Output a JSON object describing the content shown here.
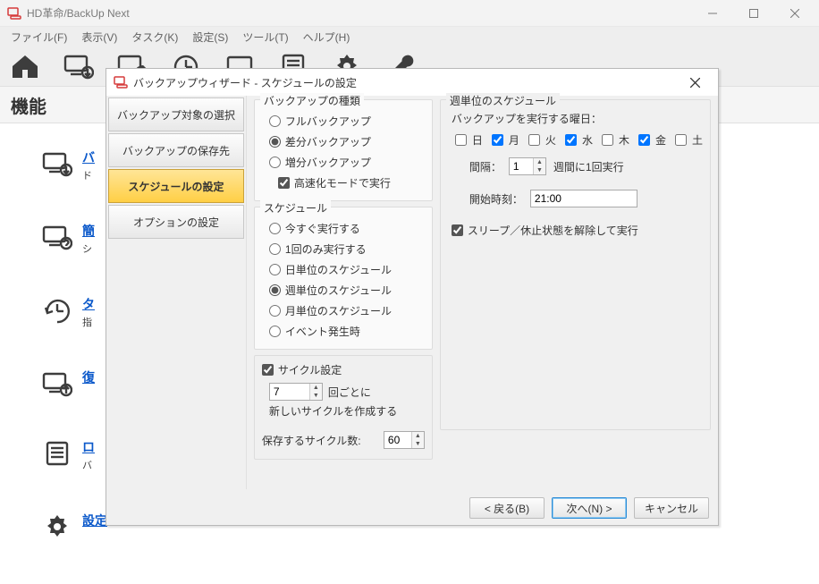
{
  "app": {
    "title": "HD革命/BackUp Next"
  },
  "menu": {
    "file": "ファイル(F)",
    "view": "表示(V)",
    "task": "タスク(K)",
    "settings": "設定(S)",
    "tools": "ツール(T)",
    "help": "ヘルプ(H)"
  },
  "feat_header": "機能",
  "sidebar": {
    "items": [
      {
        "link": "バ",
        "desc": "ド"
      },
      {
        "link": "簡",
        "desc": "シ"
      },
      {
        "link": "タ",
        "desc": "指"
      },
      {
        "link": "復",
        "desc": ""
      },
      {
        "link": "ロ",
        "desc": "バ"
      },
      {
        "link": "設定",
        "desc": ""
      }
    ]
  },
  "wizard": {
    "title": "バックアップウィザード - スケジュールの設定",
    "steps": [
      "バックアップ対象の選択",
      "バックアップの保存先",
      "スケジュールの設定",
      "オプションの設定"
    ],
    "backup_type": {
      "title": "バックアップの種類",
      "full": "フルバックアップ",
      "diff": "差分バックアップ",
      "inc": "増分バックアップ",
      "fast": "高速化モードで実行"
    },
    "schedule": {
      "title": "スケジュール",
      "now": "今すぐ実行する",
      "once": "1回のみ実行する",
      "daily": "日単位のスケジュール",
      "weekly": "週単位のスケジュール",
      "monthly": "月単位のスケジュール",
      "event": "イベント発生時"
    },
    "cycle": {
      "title": "サイクル設定",
      "every_value": "7",
      "every_suffix": "回ごとに",
      "create_new": "新しいサイクルを作成する",
      "keep_label": "保存するサイクル数:",
      "keep_value": "60"
    },
    "weekly": {
      "title": "週単位のスケジュール",
      "run_days_label": "バックアップを実行する曜日：",
      "days": {
        "sun": "日",
        "mon": "月",
        "tue": "火",
        "wed": "水",
        "thu": "木",
        "fri": "金",
        "sat": "土"
      },
      "interval_label": "間隔：",
      "interval_value": "1",
      "interval_suffix": "週間に1回実行",
      "start_label": "開始時刻：",
      "start_value": "21:00",
      "wake": "スリープ／休止状態を解除して実行"
    },
    "buttons": {
      "back": "< 戻る(B)",
      "next": "次へ(N) >",
      "cancel": "キャンセル"
    }
  }
}
